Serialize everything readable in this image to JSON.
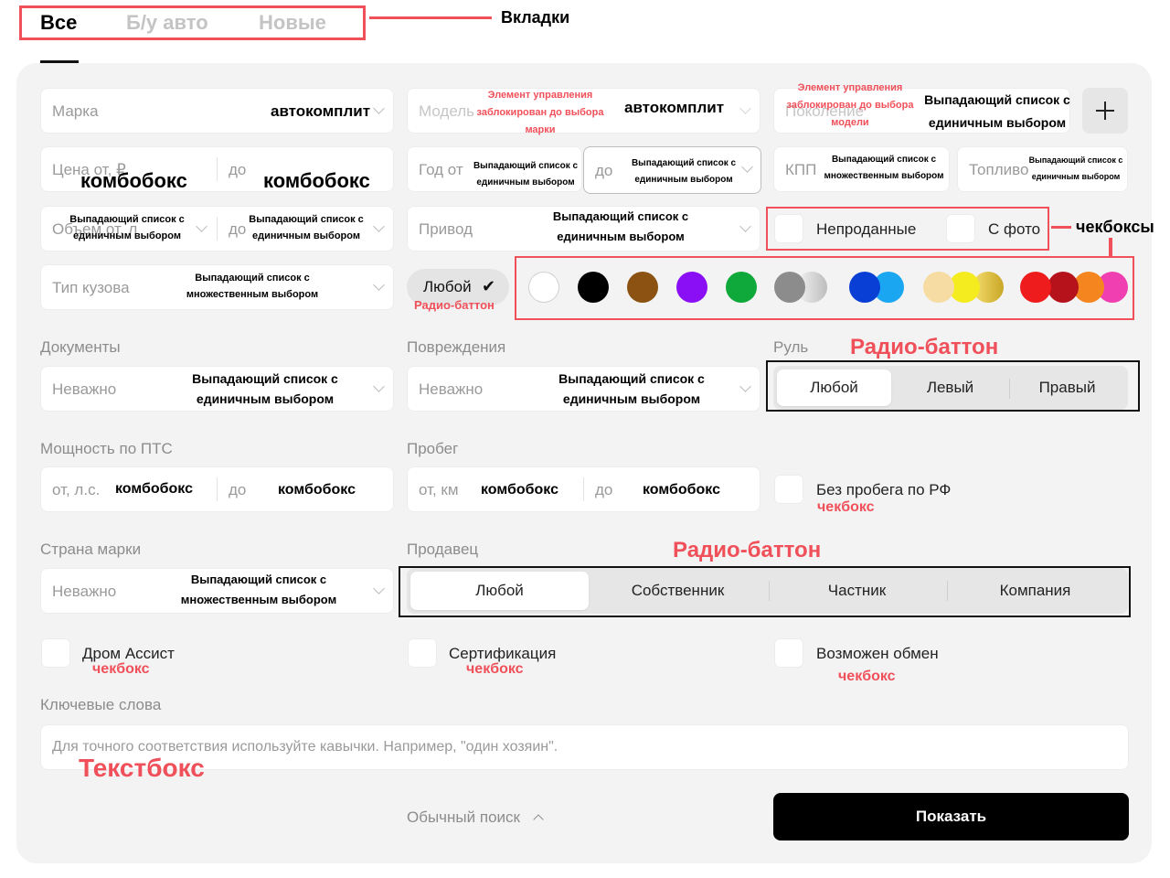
{
  "tabs": {
    "items": [
      "Все",
      "Б/у авто",
      "Новые"
    ],
    "callout": "Вкладки"
  },
  "row1": {
    "brand": {
      "placeholder": "Марка",
      "note": "автокомплит"
    },
    "model": {
      "placeholder": "Модель",
      "note": "автокомплит",
      "lock_note": "Элемент управления заблокирован до выбора марки"
    },
    "generation": {
      "placeholder": "Поколение",
      "note": "Выпадающий список с единичным выбором",
      "lock_note": "Элемент управления заблокирован до выбора модели"
    },
    "add_icon": "plus-icon"
  },
  "row2": {
    "price": {
      "from": "Цена от, ₽",
      "to": "до",
      "note": "комбобокс"
    },
    "year": {
      "from": "Год от",
      "to": "до",
      "note": "Выпадающий список с единичным выбором"
    },
    "gearbox": {
      "placeholder": "КПП",
      "note": "Выпадающий список с множественным выбором"
    },
    "fuel": {
      "placeholder": "Топливо",
      "note": "Выпадающий список с единичным выбором"
    }
  },
  "row3": {
    "volume": {
      "from": "Объем от, л",
      "to": "до",
      "note": "Выпадающий список с единичным выбором"
    },
    "drive": {
      "placeholder": "Привод",
      "note": "Выпадающий список с единичным выбором"
    },
    "unsold": "Непроданные",
    "with_photo": "С фото",
    "checkbox_callout": "чекбоксы"
  },
  "row4": {
    "body": {
      "placeholder": "Тип кузова",
      "note": "Выпадающий список с множественным выбором"
    },
    "any_color": {
      "label": "Любой",
      "check": "✔",
      "note": "Радио-баттон"
    },
    "colors": [
      "white",
      "black",
      "brown",
      "purple",
      "green",
      "silver-gray",
      "blue",
      "beige-yellow-gold",
      "red-maroon-orange-pink"
    ]
  },
  "row5": {
    "documents": {
      "label": "Документы",
      "placeholder": "Неважно",
      "note": "Выпадающий список с единичным выбором"
    },
    "damage": {
      "label": "Повреждения",
      "placeholder": "Неважно",
      "note": "Выпадающий список с единичным выбором"
    },
    "wheel": {
      "label": "Руль",
      "note": "Радио-баттон",
      "options": [
        "Любой",
        "Левый",
        "Правый"
      ]
    }
  },
  "row6": {
    "power": {
      "label": "Мощность по ПТС",
      "from": "от, л.с.",
      "to": "до",
      "note": "комбобокс"
    },
    "mileage": {
      "label": "Пробег",
      "from": "от, км",
      "to": "до",
      "note": "комбобокс"
    },
    "no_ru_mileage": {
      "label": "Без пробега по РФ",
      "note": "чекбокс"
    }
  },
  "row7": {
    "country": {
      "label": "Страна марки",
      "placeholder": "Неважно",
      "note": "Выпадающий список с множественным выбором"
    },
    "seller": {
      "label": "Продавец",
      "note": "Радио-баттон",
      "options": [
        "Любой",
        "Собственник",
        "Частник",
        "Компания"
      ]
    }
  },
  "row8": {
    "drom_assist": {
      "label": "Дром Ассист",
      "note": "чекбокс"
    },
    "certification": {
      "label": "Сертификация",
      "note": "чекбокс"
    },
    "exchange": {
      "label": "Возможен обмен",
      "note": "чекбокс"
    }
  },
  "keywords": {
    "label": "Ключевые слова",
    "placeholder": "Для точного соответствия используйте кавычки. Например, \"один хозяин\".",
    "note": "Текстбокс"
  },
  "footer": {
    "simple_search": "Обычный поиск",
    "show": "Показать"
  }
}
